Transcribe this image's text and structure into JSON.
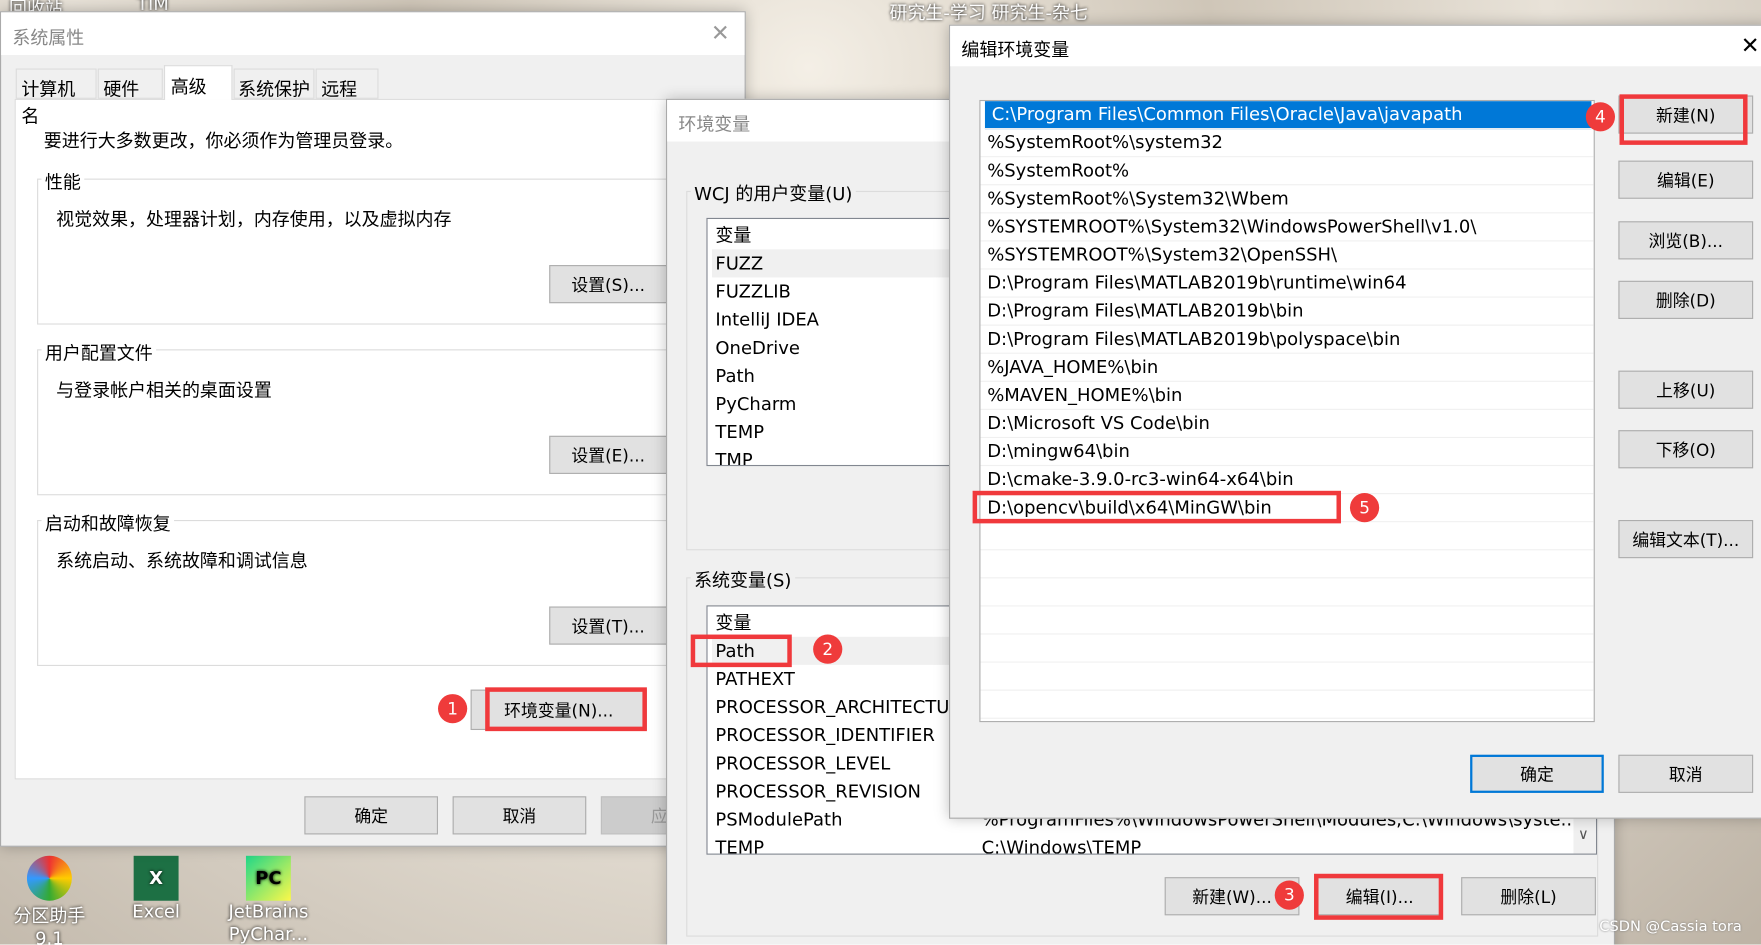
{
  "desktop": {
    "top_labels": [
      "回收站",
      "TIM",
      "研究生-学习 研究生-杂七"
    ],
    "icons": [
      {
        "label": "分区助手 9.1"
      },
      {
        "label": "Excel"
      },
      {
        "label": "JetBrains PyChar..."
      }
    ],
    "watermark": "CSDN @Cassia tora"
  },
  "sysprops": {
    "title": "系统属性",
    "tabs": [
      "计算机名",
      "硬件",
      "高级",
      "系统保护",
      "远程"
    ],
    "active_tab": "高级",
    "admin_note": "要进行大多数更改，你必须作为管理员登录。",
    "groups": [
      {
        "label": "性能",
        "desc": "视觉效果，处理器计划，内存使用，以及虚拟内存",
        "button": "设置(S)..."
      },
      {
        "label": "用户配置文件",
        "desc": "与登录帐户相关的桌面设置",
        "button": "设置(E)..."
      },
      {
        "label": "启动和故障恢复",
        "desc": "系统启动、系统故障和调试信息",
        "button": "设置(T)..."
      }
    ],
    "env_button": "环境变量(N)...",
    "ok": "确定",
    "cancel": "取消",
    "apply": "应用"
  },
  "envvars": {
    "title": "环境变量",
    "user_group": "WCJ 的用户变量(U)",
    "col_var": "变量",
    "user_vars": [
      "FUZZ",
      "FUZZLIB",
      "IntelliJ IDEA",
      "OneDrive",
      "Path",
      "PyCharm",
      "TEMP",
      "TMP"
    ],
    "sys_group": "系统变量(S)",
    "sys_vars": [
      {
        "name": "Path",
        "value": ""
      },
      {
        "name": "PATHEXT",
        "value": ""
      },
      {
        "name": "PROCESSOR_ARCHITECTURE",
        "value": ""
      },
      {
        "name": "PROCESSOR_IDENTIFIER",
        "value": ""
      },
      {
        "name": "PROCESSOR_LEVEL",
        "value": ""
      },
      {
        "name": "PROCESSOR_REVISION",
        "value": ""
      },
      {
        "name": "PSModulePath",
        "value": "%ProgramFiles%\\WindowsPowerShell\\Modules;C:\\Windows\\syste..."
      },
      {
        "name": "TEMP",
        "value": "C:\\Windows\\TEMP"
      }
    ],
    "selected_sys_var": "Path",
    "new": "新建(W)...",
    "edit": "编辑(I)...",
    "delete": "删除(L)"
  },
  "editenv": {
    "title": "编辑环境变量",
    "entries": [
      "C:\\Program Files\\Common Files\\Oracle\\Java\\javapath",
      "%SystemRoot%\\system32",
      "%SystemRoot%",
      "%SystemRoot%\\System32\\Wbem",
      "%SYSTEMROOT%\\System32\\WindowsPowerShell\\v1.0\\",
      "%SYSTEMROOT%\\System32\\OpenSSH\\",
      "D:\\Program Files\\MATLAB2019b\\runtime\\win64",
      "D:\\Program Files\\MATLAB2019b\\bin",
      "D:\\Program Files\\MATLAB2019b\\polyspace\\bin",
      "%JAVA_HOME%\\bin",
      "%MAVEN_HOME%\\bin",
      "D:\\Microsoft VS Code\\bin",
      "D:\\mingw64\\bin",
      "D:\\cmake-3.9.0-rc3-win64-x64\\bin",
      "D:\\opencv\\build\\x64\\MinGW\\bin"
    ],
    "buttons": [
      "新建(N)",
      "编辑(E)",
      "浏览(B)...",
      "删除(D)",
      "上移(U)",
      "下移(O)",
      "编辑文本(T)..."
    ],
    "ok": "确定",
    "cancel": "取消",
    "selection_color": "#0078d7"
  },
  "annotations": {
    "highlight_color": "#f0393c",
    "steps": [
      "1",
      "2",
      "3",
      "4",
      "5"
    ]
  }
}
